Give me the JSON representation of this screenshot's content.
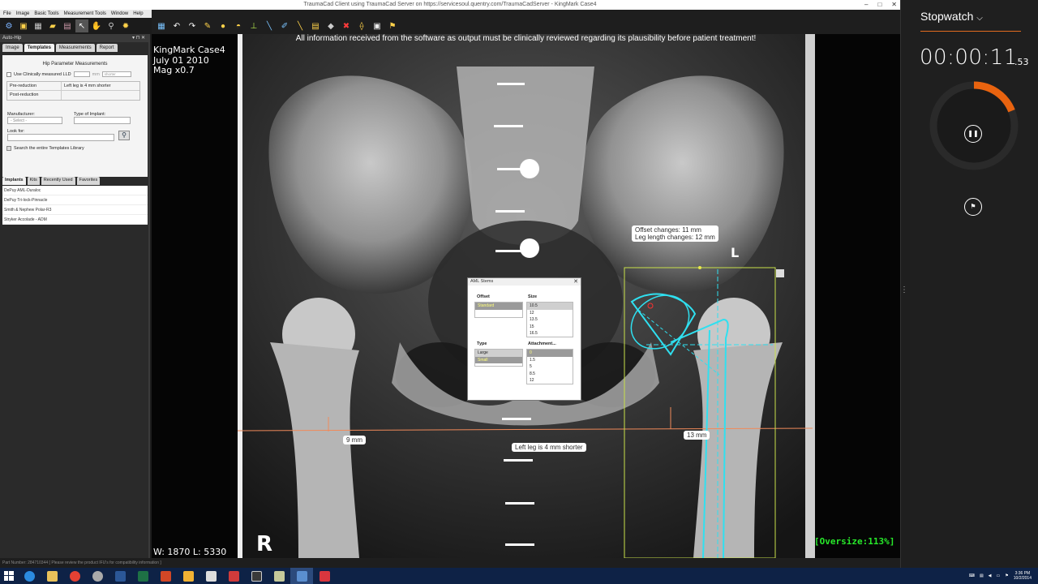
{
  "window": {
    "title": "TraumaCad Client using TraumaCad Server on https://servicesoul.quentry.com/TraumaCadServer - KingMark Case4",
    "controls": [
      "–",
      "□",
      "✕"
    ]
  },
  "menu": [
    "File",
    "Image",
    "Basic Tools",
    "Measurement Tools",
    "Window",
    "Help"
  ],
  "panel": {
    "header": "Auto-Hip",
    "header_ctrl": "▾ ⊓ ✕",
    "tabs": [
      "Image",
      "Templates",
      "Measurements",
      "Report"
    ],
    "section_title": "Hip Parameter Measurements",
    "clinical_lld_label": "Use Clinically measured LLD",
    "clinical_unit": "mm",
    "clinical_select": "shorter",
    "rows": [
      {
        "label": "Pre-reduction",
        "value": "Left leg is 4 mm shorter"
      },
      {
        "label": "Post-reduction",
        "value": ""
      }
    ],
    "manufacturer_label": "Manufacturer:",
    "manufacturer_value": "- Select -",
    "implant_type_label": "Type of Implant:",
    "look_for_label": "Look for:",
    "search_library_label": "Search the entire Templates Library",
    "lower_tabs": [
      "Implants",
      "Kits",
      "Recently Used",
      "Favorites"
    ],
    "implants": [
      "DePuy AML-Duraloc",
      "DePuy Tri-lock-Pinnacle",
      "Smith & Nephew Polar-R3",
      "Stryker Accolade - ADM"
    ]
  },
  "viewer": {
    "warning": "All information received from the software as output must be clinically reviewed regarding its plausibility before patient treatment!",
    "case_name": "KingMark Case4",
    "case_date": "July 01 2010",
    "magnification": "Mag x0.7",
    "window_level": "W: 1870 L: 5330",
    "oversize": "[Oversize:113%]",
    "offset_changes": "Offset changes: 11 mm",
    "leg_length_changes": "Leg length changes: 12 mm",
    "left_marker": "L",
    "right_marker": "R",
    "meas_left": "9 mm",
    "meas_right": "13 mm",
    "leg_shorter": "Left leg is 4 mm shorter"
  },
  "popup": {
    "title": "AML Stems",
    "offset_header": "Offset",
    "offset_options": [
      "Standard"
    ],
    "size_header": "Size",
    "size_options": [
      "10.5",
      "12",
      "13.5",
      "15",
      "16.5"
    ],
    "type_header": "Type",
    "type_options": [
      "Large",
      "Small"
    ],
    "attachment_header": "Attachment...",
    "attachment_options": [
      "0",
      "1.5",
      "5",
      "8.5",
      "12"
    ]
  },
  "stopwatch": {
    "title": "Stopwatch",
    "time": "00:00:11",
    "hundredths": ".53",
    "accent": "#e8630f",
    "progress_fraction": 0.19
  },
  "status": {
    "text": "Part Number: 284710344 [ Please review the product IFU's for compatibility information ]"
  },
  "taskbar": {
    "clock_time": "3:36 PM",
    "clock_date": "10/2/2014"
  }
}
